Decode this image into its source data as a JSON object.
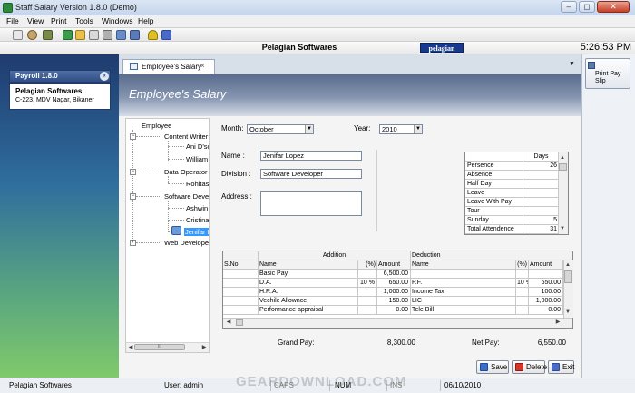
{
  "window": {
    "title": "Staff Salary Version 1.8.0 (Demo)",
    "buttons": [
      "–",
      "◻",
      "✕"
    ]
  },
  "menu": [
    "File",
    "View",
    "Print",
    "Tools",
    "Windows",
    "Help"
  ],
  "header": {
    "company": "Pelagian Softwares",
    "logo_text": "pelagian",
    "clock": "5:26:53 PM"
  },
  "left_panel": {
    "heading": "Payroll 1.8.0",
    "company": "Pelagian Softwares",
    "address": "C-223, MDV Nagar, Bikaner"
  },
  "right_panel": {
    "print_button": "Print Pay Slip"
  },
  "tab": {
    "label": "Employee's Salary",
    "close": "×",
    "dropdown": "▼"
  },
  "form": {
    "title": "Employee's  Salary",
    "month_label": "Month:",
    "month_value": "October",
    "year_label": "Year:",
    "year_value": "2010",
    "name_label": "Name :",
    "name_value": "Jenifar Lopez",
    "division_label": "Division :",
    "division_value": "Software Developer",
    "address_label": "Address :",
    "address_value": ""
  },
  "tree": {
    "root": "Employee",
    "groups": [
      {
        "name": "Content Writer",
        "children": [
          "Ani D'sou",
          "William J"
        ]
      },
      {
        "name": "Data Operator",
        "children": [
          "Rohitash"
        ]
      },
      {
        "name": "Software Develo",
        "children": [
          "Ashwin M",
          "Cristina F",
          "Jenifar L"
        ]
      },
      {
        "name": "Web Developer",
        "children": []
      }
    ],
    "selected": "Jenifar L",
    "scroll_thumb": "III"
  },
  "days": {
    "header": "Days",
    "rows": [
      {
        "label": "Persence",
        "value": "26"
      },
      {
        "label": "Absence",
        "value": ""
      },
      {
        "label": "Half Day",
        "value": ""
      },
      {
        "label": "Leave",
        "value": ""
      },
      {
        "label": "Leave With Pay",
        "value": ""
      },
      {
        "label": "Tour",
        "value": ""
      },
      {
        "label": "Sunday",
        "value": "5"
      },
      {
        "label": "Total Attendence",
        "value": "31"
      }
    ]
  },
  "salary": {
    "group_addition": "Addition",
    "group_deduction": "Deduction",
    "columns": {
      "sno": "S.No.",
      "name": "Name",
      "pct": "(%)",
      "amount": "Amount"
    },
    "rows": [
      {
        "add_name": "Basic Pay",
        "add_pct": "",
        "add_amt": "6,500.00",
        "ded_name": "",
        "ded_pct": "",
        "ded_amt": ""
      },
      {
        "add_name": "D.A.",
        "add_pct": "10 %",
        "add_amt": "650.00",
        "ded_name": "P.F.",
        "ded_pct": "10 %",
        "ded_amt": "650.00"
      },
      {
        "add_name": "H.R.A.",
        "add_pct": "",
        "add_amt": "1,000.00",
        "ded_name": "Income Tax",
        "ded_pct": "",
        "ded_amt": "100.00"
      },
      {
        "add_name": "Vechile Allownce",
        "add_pct": "",
        "add_amt": "150.00",
        "ded_name": "LIC",
        "ded_pct": "",
        "ded_amt": "1,000.00"
      },
      {
        "add_name": "Performance appraisal",
        "add_pct": "",
        "add_amt": "0.00",
        "ded_name": "Tele Bill",
        "ded_pct": "",
        "ded_amt": "0.00"
      }
    ]
  },
  "totals": {
    "grand_label": "Grand Pay:",
    "grand_value": "8,300.00",
    "net_label": "Net Pay:",
    "net_value": "6,550.00"
  },
  "actions": {
    "save": "Save",
    "delete": "Delete",
    "exit": "Exit"
  },
  "status": {
    "company": "Pelagian Softwares",
    "user": "User: admin",
    "caps": "CAPS",
    "num": "NUM",
    "ins": "INS",
    "date": "06/10/2010"
  },
  "watermark": "GEARDOWNLOAD.COM",
  "colors": {
    "accent": "#3399ff",
    "brand": "#163a8c"
  }
}
